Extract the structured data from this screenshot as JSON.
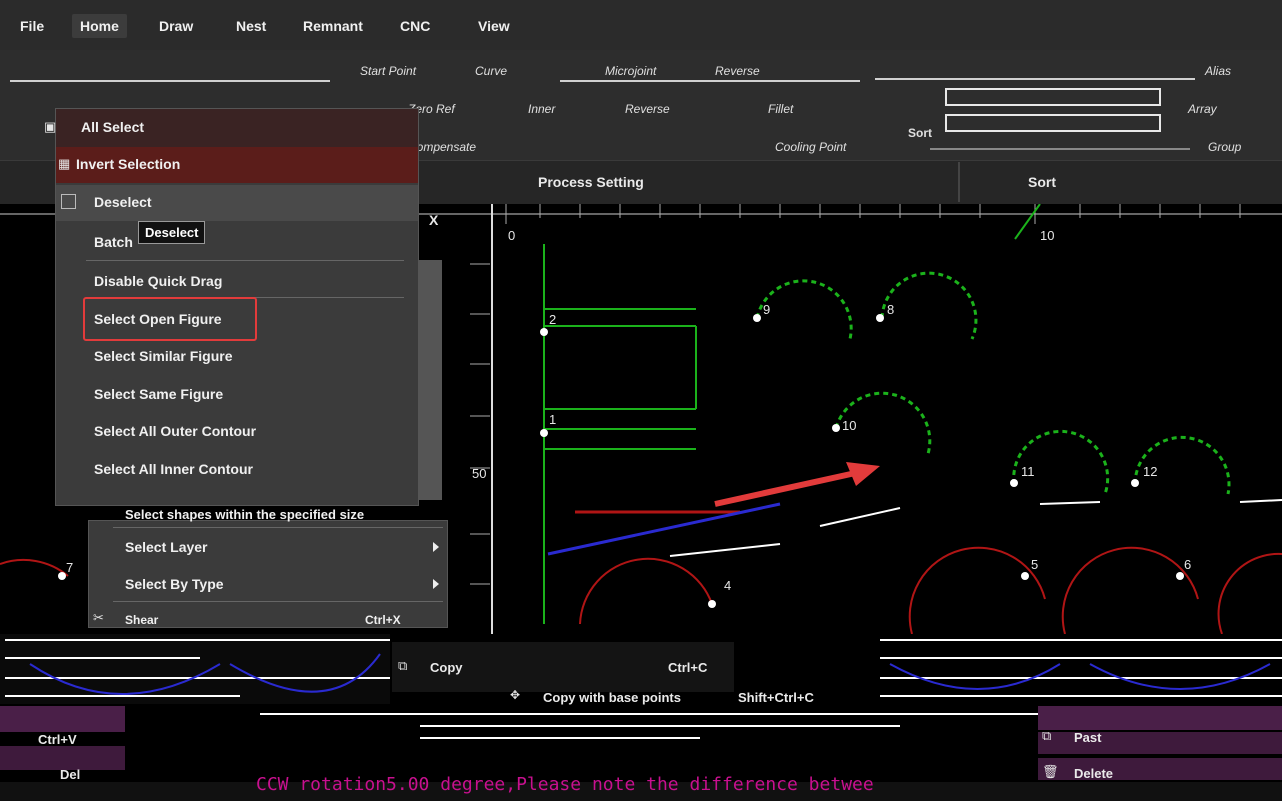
{
  "menubar": {
    "items": [
      "File",
      "Home",
      "Draw",
      "Nest",
      "Remnant",
      "CNC",
      "View"
    ],
    "active": "Home"
  },
  "ribbon": {
    "row1": [
      "Start Point",
      "Curve",
      "Microjoint",
      "Reverse",
      "Alias"
    ],
    "row2": [
      "Zero Ref",
      "Inner",
      "Reverse",
      "Fillet",
      "Array"
    ],
    "row3": [
      "Compensate",
      "Cooling Point",
      "Group"
    ],
    "sort_label": "Sort",
    "groups": [
      "Process Setting",
      "Sort"
    ]
  },
  "context_menu": {
    "items": [
      {
        "label": "All Select",
        "icon": "select-all-icon"
      },
      {
        "label": "Invert Selection",
        "icon": "invert-selection-icon"
      },
      {
        "label": "Deselect",
        "icon": "checkbox-icon"
      },
      {
        "label": "Batch"
      },
      {
        "label": "Disable Quick Drag"
      },
      {
        "label": "Select Open Figure"
      },
      {
        "label": "Select Similar Figure"
      },
      {
        "label": "Select Same Figure"
      },
      {
        "label": "Select All Outer Contour"
      },
      {
        "label": "Select All Inner Contour"
      }
    ],
    "tooltip": "Deselect",
    "highlighted": "Select Open Figure"
  },
  "sub_menu": {
    "items": [
      {
        "label": "Select shapes within the specified size"
      },
      {
        "label": "Select Layer",
        "has_submenu": true
      },
      {
        "label": "Select By Type",
        "has_submenu": true
      },
      {
        "label": "Shear",
        "shortcut": "Ctrl+X",
        "icon": "scissors-icon"
      }
    ]
  },
  "edit_menu": {
    "copy": {
      "label": "Copy",
      "shortcut": "Ctrl+C"
    },
    "copy_base": {
      "label": "Copy with base points",
      "shortcut": "Shift+Ctrl+C"
    },
    "paste": {
      "label": "Past",
      "shortcut": "Ctrl+V"
    },
    "delete": {
      "label": "Delete",
      "shortcut": "Del"
    }
  },
  "canvas": {
    "ruler": {
      "x_axis": "X",
      "ticks": [
        "0",
        "10",
        "50"
      ]
    },
    "labels": [
      "1",
      "2",
      "4",
      "5",
      "6",
      "7",
      "8",
      "9",
      "10",
      "11",
      "12"
    ]
  },
  "command_line": "CCW rotation5.00 degree,Please note the difference betwee",
  "colors": {
    "accent_red": "#e23b3b",
    "command_text": "#c8108f",
    "green_shape": "#1bb21b",
    "red_shape": "#b01515"
  }
}
